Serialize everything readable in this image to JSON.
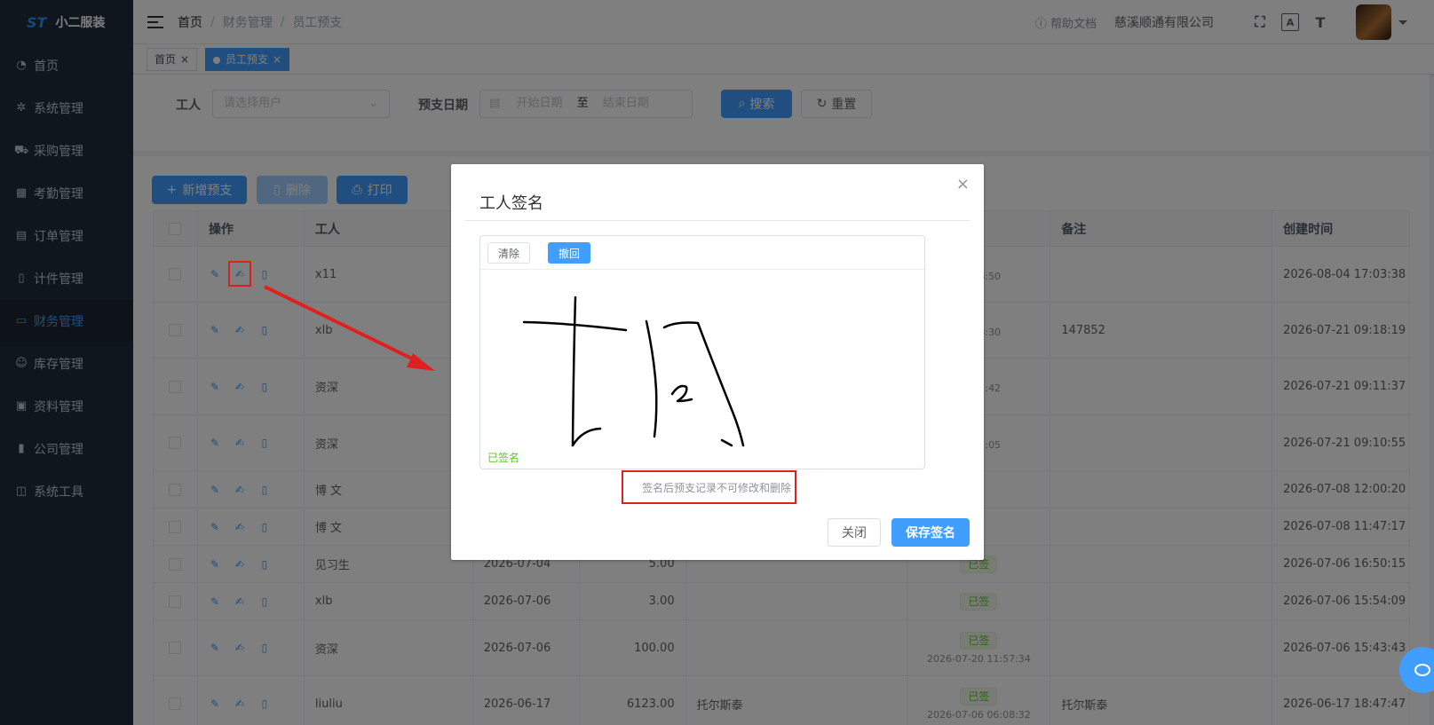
{
  "app": {
    "name": "小二服装"
  },
  "sidebar": {
    "items": [
      {
        "label": "首页",
        "icon": "dashboard-icon"
      },
      {
        "label": "系统管理",
        "icon": "gear-icon"
      },
      {
        "label": "采购管理",
        "icon": "cart-icon"
      },
      {
        "label": "考勤管理",
        "icon": "grid-icon"
      },
      {
        "label": "订单管理",
        "icon": "order-icon"
      },
      {
        "label": "计件管理",
        "icon": "book-icon"
      },
      {
        "label": "财务管理",
        "icon": "monitor-icon",
        "active": true
      },
      {
        "label": "库存管理",
        "icon": "user-icon"
      },
      {
        "label": "资料管理",
        "icon": "document-icon"
      },
      {
        "label": "公司管理",
        "icon": "chart-icon"
      },
      {
        "label": "系统工具",
        "icon": "toolbox-icon"
      }
    ]
  },
  "header": {
    "breadcrumb": [
      "首页",
      "财务管理",
      "员工预支"
    ],
    "help": "帮助文档",
    "company": "慈溪顺通有限公司"
  },
  "tags": [
    {
      "label": "首页",
      "close": "×"
    },
    {
      "label": "员工预支",
      "close": "×",
      "active": true
    }
  ],
  "search": {
    "worker_label": "工人",
    "worker_placeholder": "请选择用户",
    "date_label": "预支日期",
    "start_placeholder": "开始日期",
    "range_sep": "至",
    "end_placeholder": "结束日期",
    "search_btn": "搜索",
    "reset_btn": "重置"
  },
  "toolbar": {
    "add_btn": "新增预支",
    "delete_btn": "删除",
    "print_btn": "打印"
  },
  "table": {
    "headers": {
      "op": "操作",
      "worker": "工人",
      "remark": "备注",
      "created": "创建时间"
    },
    "rows": [
      {
        "worker": "x11",
        "date": "",
        "amount": "",
        "item": "",
        "status": "",
        "sign_time": "14:16:50",
        "remark": "",
        "created": "2026-08-04 17:03:38"
      },
      {
        "worker": "xlb",
        "date": "",
        "amount": "",
        "item": "",
        "status": "",
        "sign_time": "09:18:30",
        "remark": "147852",
        "created": "2026-07-21 09:18:19"
      },
      {
        "worker": "资深",
        "date": "",
        "amount": "",
        "item": "",
        "status": "",
        "sign_time": "09:11:42",
        "remark": "",
        "created": "2026-07-21 09:11:37"
      },
      {
        "worker": "资深",
        "date": "",
        "amount": "",
        "item": "",
        "status": "",
        "sign_time": "09:11:05",
        "remark": "",
        "created": "2026-07-21 09:10:55"
      },
      {
        "worker": "博 文",
        "date": "",
        "amount": "",
        "item": "",
        "status": "",
        "sign_time": "",
        "remark": "",
        "created": "2026-07-08 12:00:20"
      },
      {
        "worker": "博 文",
        "date": "",
        "amount": "",
        "item": "",
        "status": "",
        "sign_time": "",
        "remark": "",
        "created": "2026-07-08 11:47:17"
      },
      {
        "worker": "见习生",
        "date": "2026-07-04",
        "amount": "5.00",
        "item": "",
        "status": "已签",
        "sign_time": "",
        "remark": "",
        "created": "2026-07-06 16:50:15"
      },
      {
        "worker": "xlb",
        "date": "2026-07-06",
        "amount": "3.00",
        "item": "",
        "status": "已签",
        "sign_time": "",
        "remark": "",
        "created": "2026-07-06 15:54:09"
      },
      {
        "worker": "资深",
        "date": "2026-07-06",
        "amount": "100.00",
        "item": "",
        "status": "已签",
        "sign_time": "2026-07-20 11:57:34",
        "remark": "",
        "created": "2026-07-06 15:43:43"
      },
      {
        "worker": "liuliu",
        "date": "2026-06-17",
        "amount": "6123.00",
        "item": "托尔斯泰",
        "status": "已签",
        "sign_time": "2026-07-06 06:08:32",
        "remark": "托尔斯泰",
        "created": "2026-06-17 18:47:47"
      }
    ]
  },
  "dialog": {
    "title": "工人签名",
    "close": "×",
    "clear_btn": "清除",
    "undo_btn": "撤回",
    "status": "已签名",
    "hint": "签名后预支记录不可修改和删除",
    "cancel_btn": "关闭",
    "save_btn": "保存签名"
  },
  "colors": {
    "primary": "#409eff",
    "sidebar_bg": "#1f2d3d",
    "annotation_red": "#e02020",
    "success": "#67c23a"
  }
}
